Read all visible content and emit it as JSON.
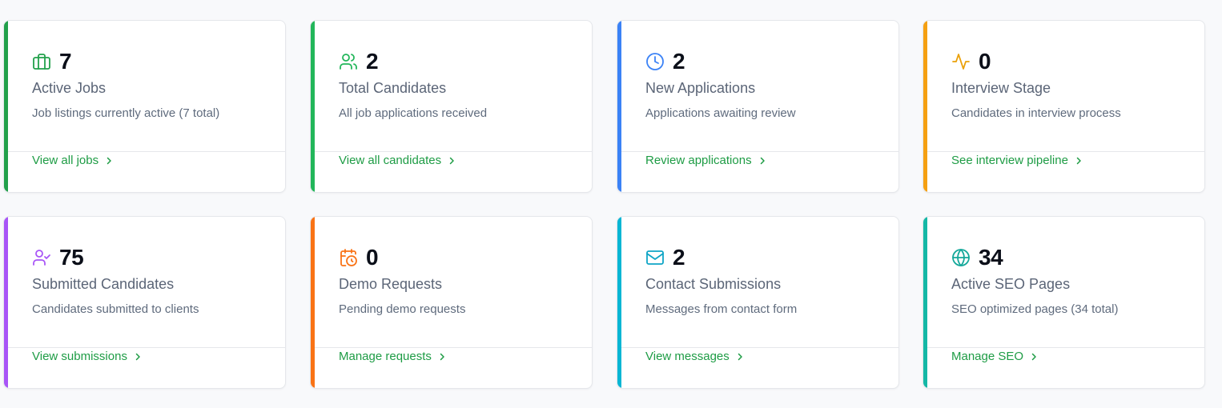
{
  "cards": [
    {
      "value": "7",
      "title": "Active Jobs",
      "description": "Job listings currently active (7 total)",
      "link": "View all jobs",
      "icon": "briefcase-icon",
      "accent": "#22a04b",
      "icon_color": "#22a04b"
    },
    {
      "value": "2",
      "title": "Total Candidates",
      "description": "All job applications received",
      "link": "View all candidates",
      "icon": "users-icon",
      "accent": "#22b65a",
      "icon_color": "#22b65a"
    },
    {
      "value": "2",
      "title": "New Applications",
      "description": "Applications awaiting review",
      "link": "Review applications",
      "icon": "clock-icon",
      "accent": "#3b82f6",
      "icon_color": "#3b82f6"
    },
    {
      "value": "0",
      "title": "Interview Stage",
      "description": "Candidates in interview process",
      "link": "See interview pipeline",
      "icon": "activity-icon",
      "accent": "#f5a012",
      "icon_color": "#eaa008"
    },
    {
      "value": "75",
      "title": "Submitted Candidates",
      "description": "Candidates submitted to clients",
      "link": "View submissions",
      "icon": "user-check-icon",
      "accent": "#a855f7",
      "icon_color": "#a855f7"
    },
    {
      "value": "0",
      "title": "Demo Requests",
      "description": "Pending demo requests",
      "link": "Manage requests",
      "icon": "calendar-clock-icon",
      "accent": "#f97316",
      "icon_color": "#f97316"
    },
    {
      "value": "2",
      "title": "Contact Submissions",
      "description": "Messages from contact form",
      "link": "View messages",
      "icon": "mail-icon",
      "accent": "#06b6d4",
      "icon_color": "#0ea5c6"
    },
    {
      "value": "34",
      "title": "Active SEO Pages",
      "description": "SEO optimized pages (34 total)",
      "link": "Manage SEO",
      "icon": "globe-icon",
      "accent": "#14b8a6",
      "icon_color": "#14a89a"
    }
  ],
  "link_color": "#1e9c45"
}
